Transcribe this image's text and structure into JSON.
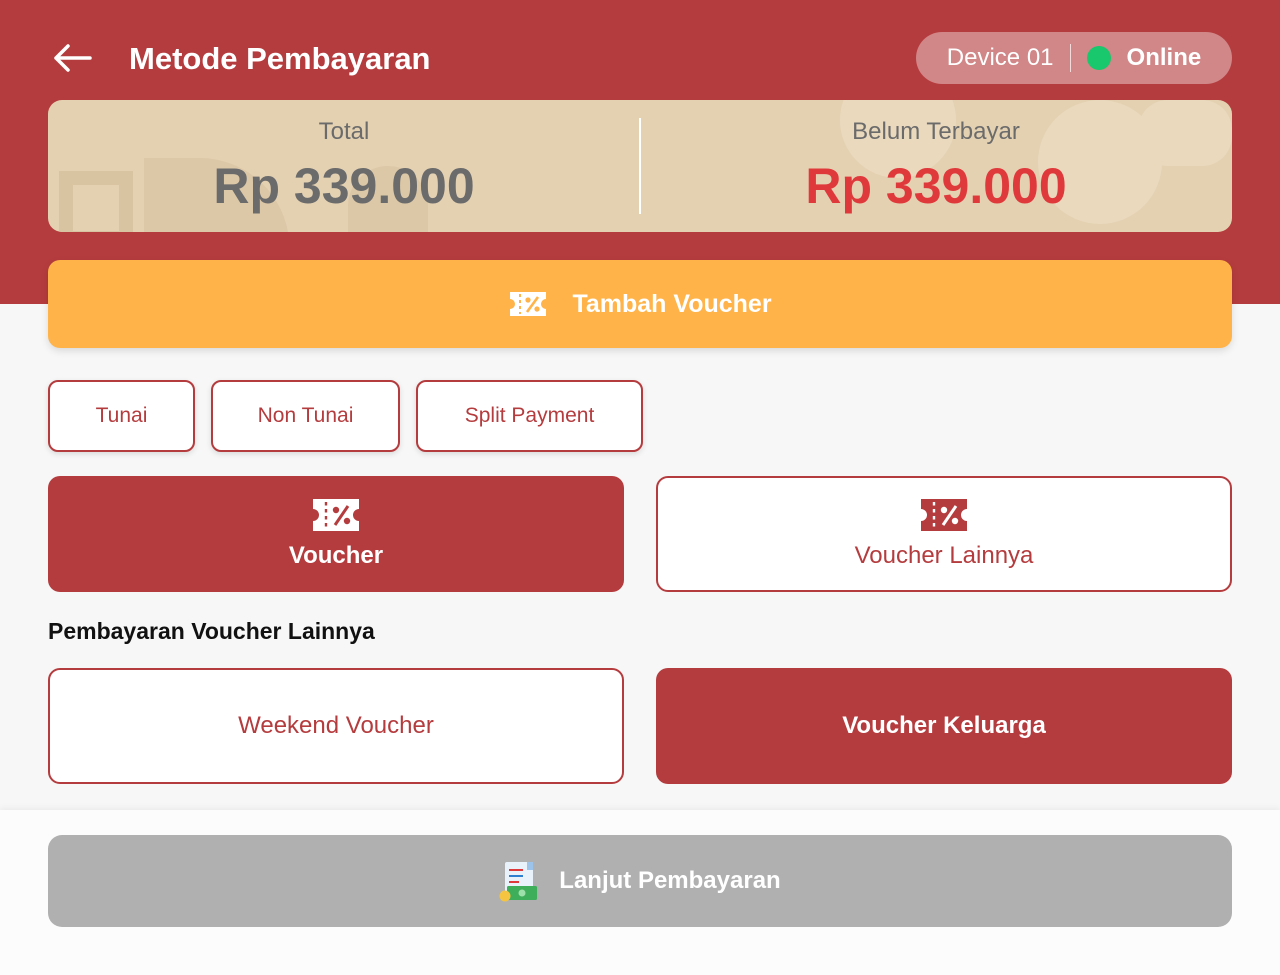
{
  "header": {
    "title": "Metode Pembayaran",
    "back_icon": "arrow-left-icon",
    "device_label": "Device 01",
    "status_label": "Online",
    "status_color": "#19c76d"
  },
  "summary": {
    "total_label": "Total",
    "total_amount": "Rp 339.000",
    "unpaid_label": "Belum Terbayar",
    "unpaid_amount": "Rp 339.000"
  },
  "voucher_add": {
    "label": "Tambah Voucher",
    "icon": "voucher-icon"
  },
  "payment_tabs": [
    {
      "label": "Tunai"
    },
    {
      "label": "Non Tunai"
    },
    {
      "label": "Split Payment"
    }
  ],
  "voucher_options": [
    {
      "label": "Voucher",
      "icon": "voucher-icon",
      "selected": true
    },
    {
      "label": "Voucher Lainnya",
      "icon": "voucher-icon",
      "selected": false
    }
  ],
  "other_section": {
    "title": "Pembayaran Voucher Lainnya",
    "items": [
      {
        "label": "Weekend Voucher",
        "selected": false
      },
      {
        "label": "Voucher Keluarga",
        "selected": true
      }
    ]
  },
  "footer": {
    "continue_label": "Lanjut Pembayaran",
    "icon": "receipt-money-icon"
  },
  "colors": {
    "primary": "#b53c3e",
    "accent": "#ffb348",
    "unpaid": "#e0393c",
    "disabled": "#b0b0b0"
  }
}
